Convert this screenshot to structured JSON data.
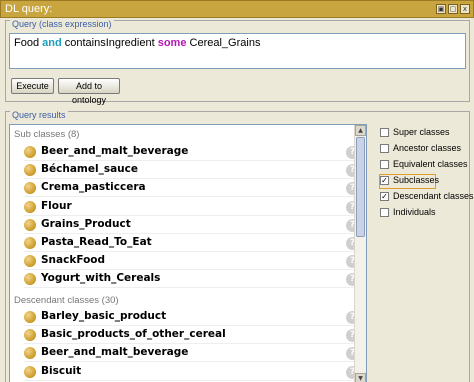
{
  "window": {
    "title": "DL query:",
    "buttons": [
      "▣",
      "▢",
      "x"
    ]
  },
  "query": {
    "group_label": "Query (class expression)",
    "expression_parts": [
      {
        "text": "Food ",
        "kind": "class"
      },
      {
        "text": "and",
        "kind": "keyword-and"
      },
      {
        "text": " containsIngredient ",
        "kind": "property"
      },
      {
        "text": "some",
        "kind": "keyword-some"
      },
      {
        "text": " Cereal_Grains",
        "kind": "class"
      }
    ],
    "execute_label": "Execute",
    "add_label": "Add to ontology"
  },
  "results": {
    "group_label": "Query results",
    "subclasses_header": "Sub classes (8)",
    "subclasses": [
      "Beer_and_malt_beverage",
      "Béchamel_sauce",
      "Crema_pasticcera",
      "Flour",
      "Grains_Product",
      "Pasta_Read_To_Eat",
      "SnackFood",
      "Yogurt_with_Cereals"
    ],
    "descendants_header": "Descendant classes (30)",
    "descendants": [
      "Barley_basic_product",
      "Basic_products_of_other_cereal",
      "Beer_and_malt_beverage",
      "Biscuit"
    ],
    "help_glyph": "?"
  },
  "options": [
    {
      "label": "Super classes",
      "checked": false
    },
    {
      "label": "Ancestor classes",
      "checked": false
    },
    {
      "label": "Equivalent classes",
      "checked": false
    },
    {
      "label": "Subclasses",
      "checked": true,
      "focused": true
    },
    {
      "label": "Descendant classes",
      "checked": true
    },
    {
      "label": "Individuals",
      "checked": false
    }
  ],
  "colors": {
    "title_bar": "#c8a53f",
    "keyword_and": "#1a9fbd",
    "keyword_some": "#b21ab2",
    "group_label": "#3b5ea8"
  }
}
